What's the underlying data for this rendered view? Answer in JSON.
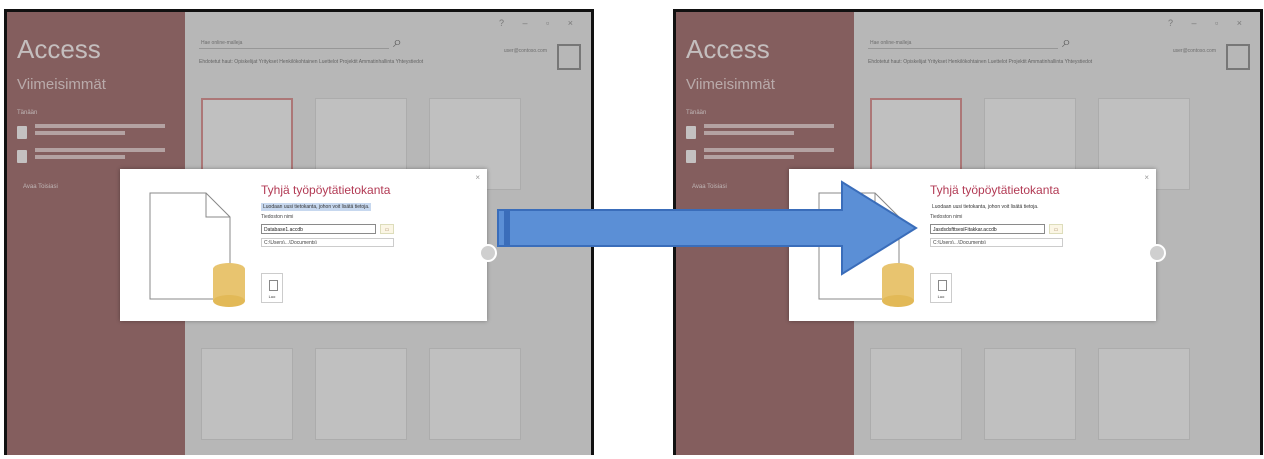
{
  "app": {
    "title": "Access",
    "subtitle": "Viimeisimmät",
    "recent_header": "Tänään",
    "open_other": "Avaa Toisiasi"
  },
  "search": {
    "placeholder": "Hae online-malleja"
  },
  "user": {
    "line1": "user@contoso.com",
    "line2": "",
    "line3": ""
  },
  "dialog": {
    "title": "Tyhjä työpöytätietokanta",
    "description": "Luodaan uusi tietokanta, johon voit lisätä tietoja.",
    "file_label": "Tiedoston nimi",
    "left_filename": "Database1.accdb",
    "right_filename": "JasdsdsfttsesiFitakkar.accdb",
    "path": "C:\\Users\\...\\Documents\\",
    "create_label": "Luo",
    "close_glyph": "×"
  },
  "icons": [
    "search-icon",
    "close-icon",
    "folder-icon",
    "document-icon",
    "database-icon",
    "globe-icon",
    "arrow-icon"
  ],
  "colors": {
    "sidebar": "#8b4e4e",
    "title": "#b23a54",
    "arrow": "#5b8fd6",
    "arrow_edge": "#3a6dba"
  }
}
